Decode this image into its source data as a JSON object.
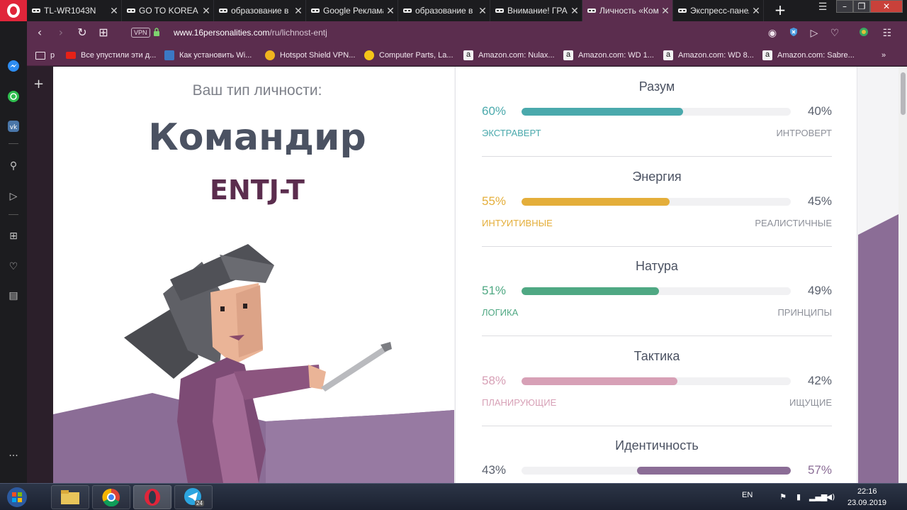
{
  "browser": {
    "tabs": [
      {
        "title": "TL-WR1043N",
        "active": false
      },
      {
        "title": "GO TO KOREA S",
        "active": false
      },
      {
        "title": "образование в",
        "active": false
      },
      {
        "title": "Google Реклама",
        "active": false
      },
      {
        "title": "образование в",
        "active": false
      },
      {
        "title": "Внимание! ГРА",
        "active": false
      },
      {
        "title": "Личность «Ком",
        "active": true
      },
      {
        "title": "Экспресс-панел",
        "active": false
      }
    ],
    "address": {
      "vpn_label": "VPN",
      "url_domain": "www.16personalities.com",
      "url_path": "/ru/lichnost-entj"
    },
    "bookmarks": [
      {
        "label": "р",
        "icon": "folder-icon"
      },
      {
        "label": "Все упустили эти д...",
        "icon": "youtube-icon"
      },
      {
        "label": "Как установить Wi...",
        "icon": "site-icon"
      },
      {
        "label": "Hotspot Shield VPN...",
        "icon": "hotspot-icon"
      },
      {
        "label": "Computer Parts, La...",
        "icon": "newegg-icon"
      },
      {
        "label": "Amazon.com: Nulax...",
        "icon": "amazon-icon"
      },
      {
        "label": "Amazon.com: WD 1...",
        "icon": "amazon-icon"
      },
      {
        "label": "Amazon.com: WD 8...",
        "icon": "amazon-icon"
      },
      {
        "label": "Amazon.com: Sabre...",
        "icon": "amazon-icon"
      }
    ]
  },
  "page": {
    "subtitle": "Ваш тип личности:",
    "type_name": "Командир",
    "type_code": "ENTJ-T",
    "traits": [
      {
        "name": "Разум",
        "left_pct": "60%",
        "right_pct": "40%",
        "left_label": "ЭКСТРАВЕРТ",
        "right_label": "ИНТРОВЕРТ",
        "color": "#4aa9ac",
        "dominant": "left",
        "fraction": 0.6
      },
      {
        "name": "Энергия",
        "left_pct": "55%",
        "right_pct": "45%",
        "left_label": "ИНТУИТИВНЫЕ",
        "right_label": "РЕАЛИСТИЧНЫЕ",
        "color": "#e4ae3a",
        "dominant": "left",
        "fraction": 0.55
      },
      {
        "name": "Натура",
        "left_pct": "51%",
        "right_pct": "49%",
        "left_label": "ЛОГИКА",
        "right_label": "ПРИНЦИПЫ",
        "color": "#4fa883",
        "dominant": "left",
        "fraction": 0.51
      },
      {
        "name": "Тактика",
        "left_pct": "58%",
        "right_pct": "42%",
        "left_label": "ПЛАНИРУЮЩИЕ",
        "right_label": "ИЩУЩИЕ",
        "color": "#d7a0b6",
        "dominant": "left",
        "fraction": 0.58
      },
      {
        "name": "Идентичность",
        "left_pct": "43%",
        "right_pct": "57%",
        "left_label": "",
        "right_label": "",
        "color": "#8b6d96",
        "dominant": "right",
        "fraction": 0.57
      }
    ]
  },
  "taskbar": {
    "lang": "EN",
    "time": "22:16",
    "date": "23.09.2019",
    "telegram_badge": "24"
  }
}
